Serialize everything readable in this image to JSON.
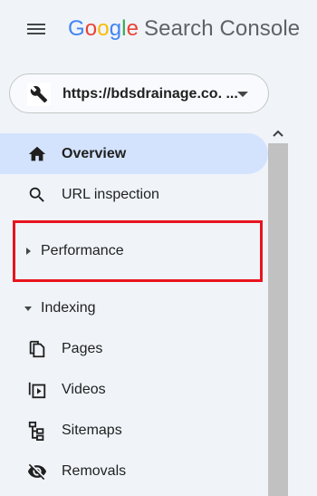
{
  "header": {
    "menu_icon": "hamburger-menu-icon",
    "logo_letters": [
      "G",
      "o",
      "o",
      "g",
      "l",
      "e"
    ],
    "product_name": "Search Console"
  },
  "property_selector": {
    "icon": "wrench-icon",
    "url": "https://bdsdrainage.co. ...",
    "dropdown_icon": "caret-down-icon"
  },
  "nav": {
    "items": [
      {
        "label": "Overview",
        "icon": "home-icon",
        "active": true
      },
      {
        "label": "URL inspection",
        "icon": "search-icon",
        "active": false
      }
    ],
    "performance": {
      "label": "Performance",
      "icon": "caret-right-icon",
      "expanded": false
    },
    "indexing": {
      "label": "Indexing",
      "icon": "caret-down-icon",
      "expanded": true,
      "items": [
        {
          "label": "Pages",
          "icon": "pages-icon"
        },
        {
          "label": "Videos",
          "icon": "video-icon"
        },
        {
          "label": "Sitemaps",
          "icon": "sitemap-icon"
        },
        {
          "label": "Removals",
          "icon": "visibility-off-icon"
        }
      ]
    }
  },
  "annotation": {
    "highlight_color": "#e8141e"
  },
  "colors": {
    "background": "#f0f4f9",
    "active_item": "#d3e3fd",
    "text": "#1f1f1f",
    "scroll_thumb": "#c1c1c1"
  }
}
